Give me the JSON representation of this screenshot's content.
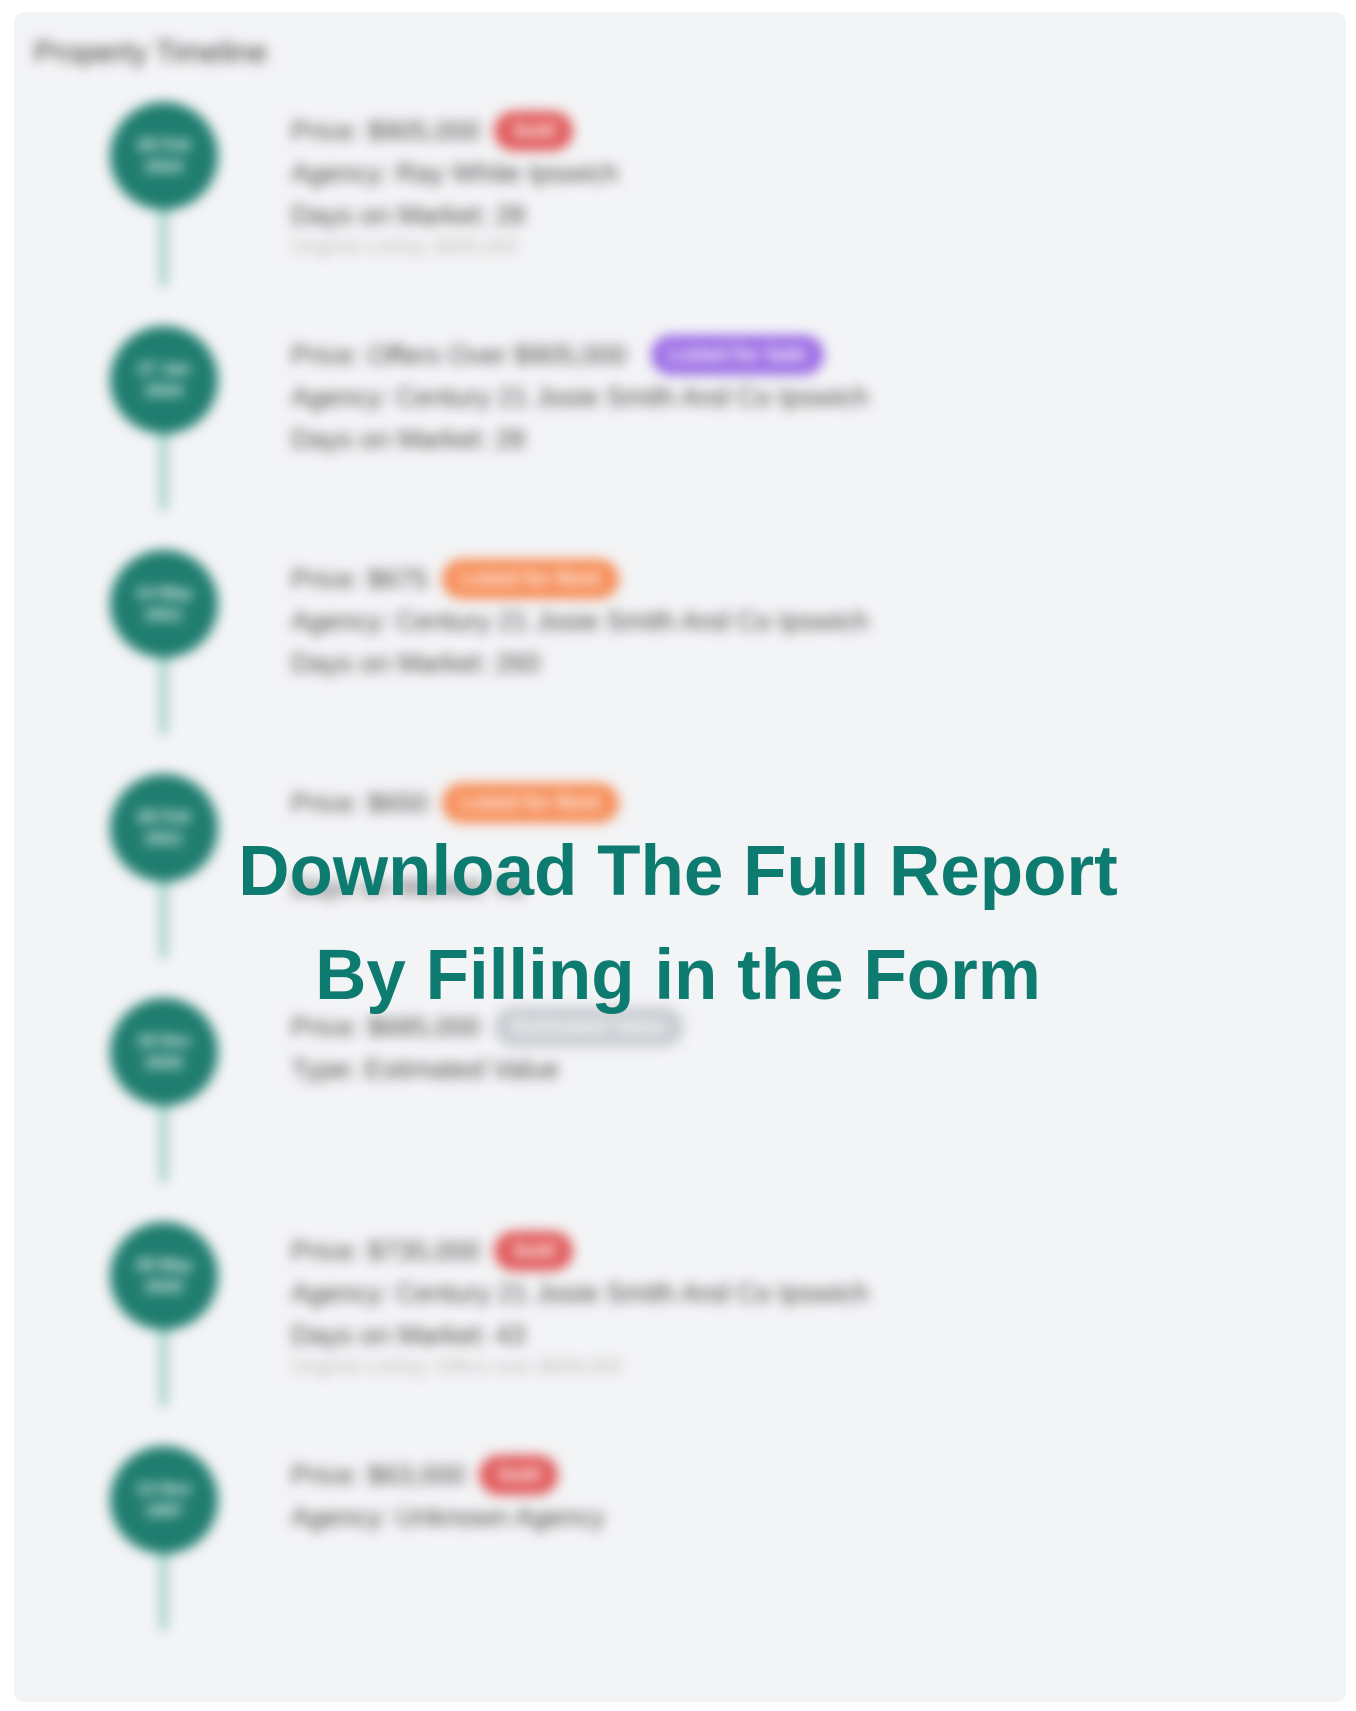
{
  "panel": {
    "title": "Property Timeline"
  },
  "entries": [
    {
      "date_line1": "28 Feb",
      "date_line2": "2024",
      "price": "Price: $905,000",
      "badge": "Sold",
      "badge_color": "#e15b5b",
      "agency": "Agency: Ray White Ipswich",
      "days": "Days on Market: 28",
      "note": "Original Listing: $905,000"
    },
    {
      "date_line1": "27 Jan",
      "date_line2": "2024",
      "price": "Price: Offers Over $905,000",
      "badge": "Listed for Sale",
      "badge_color": "#9c6de5",
      "agency": "Agency: Century 21 Josie Smith And Co Ipswich",
      "days": "Days on Market: 28",
      "note": ""
    },
    {
      "date_line1": "14 May",
      "date_line2": "2021",
      "price": "Price: $675",
      "badge": "Listed for Rent",
      "badge_color": "#f78d57",
      "agency": "Agency: Century 21 Josie Smith And Co Ipswich",
      "days": "Days on Market: 260",
      "note": ""
    },
    {
      "date_line1": "28 Feb",
      "date_line2": "2021",
      "price": "Price: $650",
      "badge": "Listed for Rent",
      "badge_color": "#f78d57",
      "agency": "",
      "days": "Days on Market: 41",
      "note": ""
    },
    {
      "date_line1": "18 Dec",
      "date_line2": "2020",
      "price": "Price: $685,000",
      "badge": "Estimated Value",
      "badge_color": "#c9ccd2",
      "agency": "Type: Estimated Value",
      "days": "",
      "note": ""
    },
    {
      "date_line1": "28 May",
      "date_line2": "2020",
      "price": "Price: $735,000",
      "badge": "Sold",
      "badge_color": "#e15b5b",
      "agency": "Agency: Century 21 Josie Smith And Co Ipswich",
      "days": "Days on Market: 43",
      "note": "Original Listing: Offers over $699,000"
    },
    {
      "date_line1": "13 Nov",
      "date_line2": "1997",
      "price": "Price: $63,000",
      "badge": "Sold",
      "badge_color": "#e15b5b",
      "agency": "Agency: Unknown Agency",
      "days": "",
      "note": ""
    }
  ],
  "overlay": {
    "line1": "Download The Full Report",
    "line2": "By Filling in the Form"
  }
}
